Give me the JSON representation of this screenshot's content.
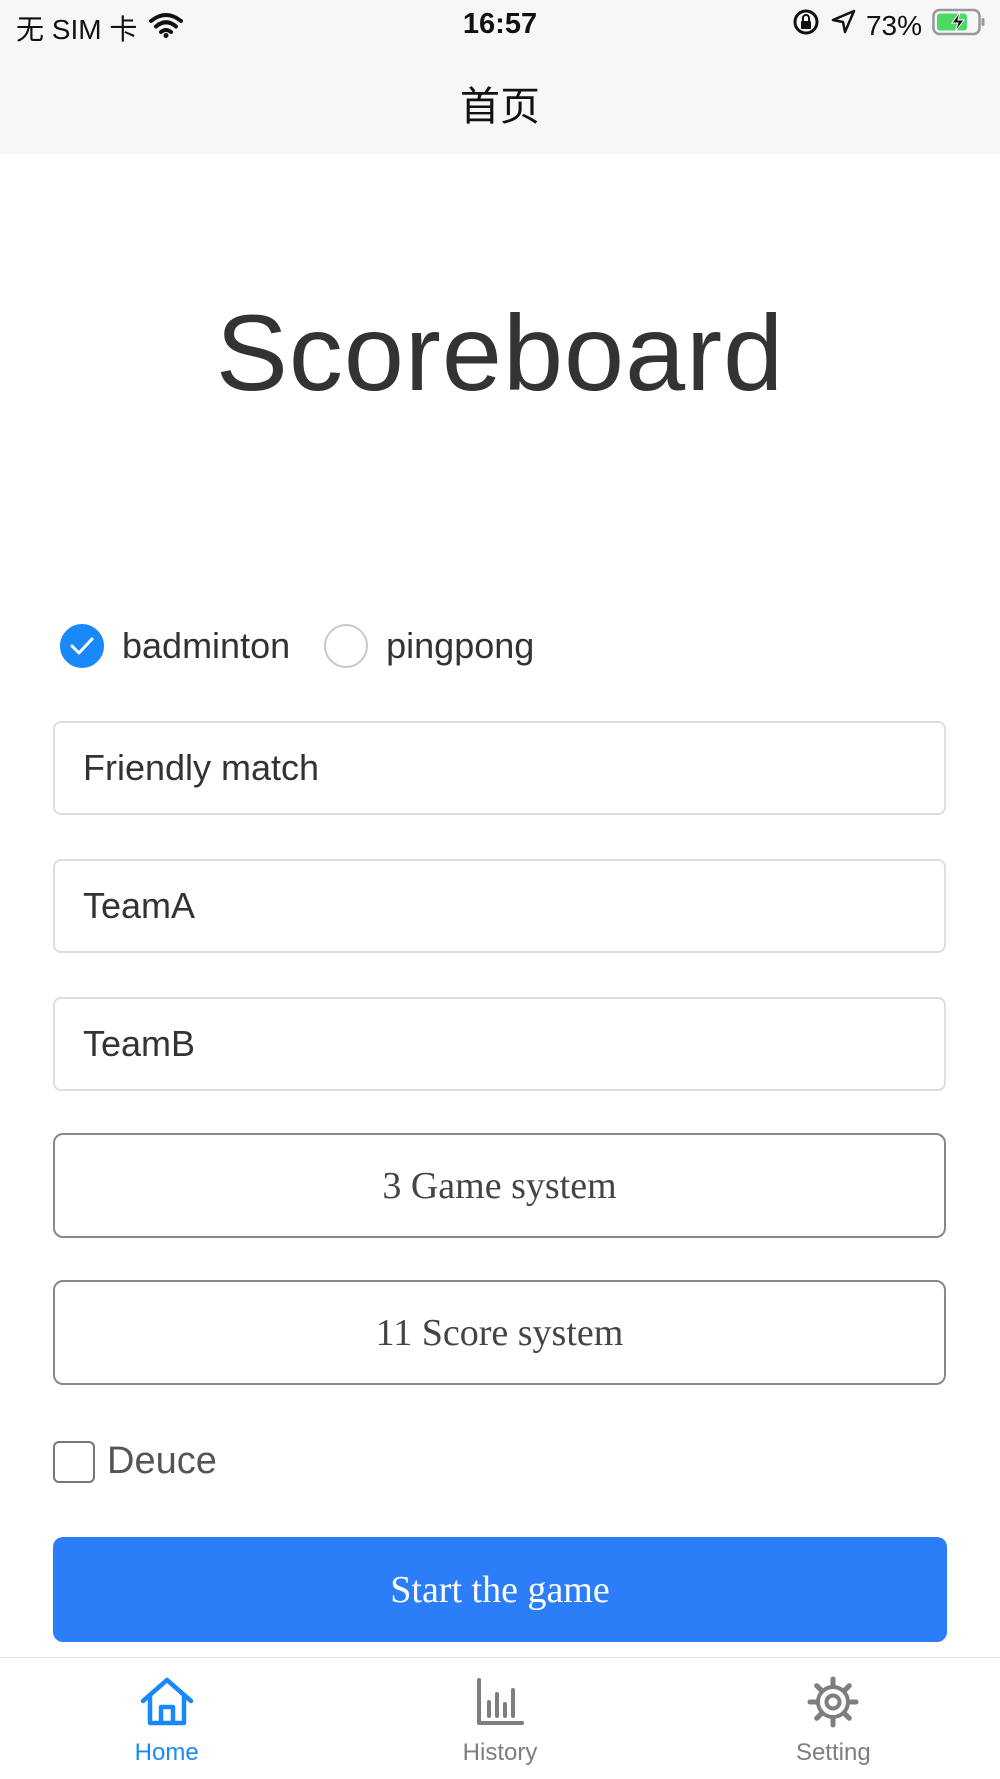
{
  "status_bar": {
    "carrier": "无 SIM 卡",
    "time": "16:57",
    "battery": "73%"
  },
  "nav": {
    "title": "首页"
  },
  "app_title": "Scoreboard",
  "sport_options": [
    {
      "label": "badminton",
      "checked": true
    },
    {
      "label": "pingpong",
      "checked": false
    }
  ],
  "fields": {
    "match_name": "Friendly match",
    "team_a": "TeamA",
    "team_b": "TeamB"
  },
  "game_system_label": "3 Game system",
  "score_system_label": "11 Score system",
  "deuce": {
    "label": "Deuce",
    "checked": false
  },
  "start_label": "Start the game",
  "tabs": [
    {
      "label": "Home",
      "icon": "home-icon",
      "active": true
    },
    {
      "label": "History",
      "icon": "bar-chart-icon",
      "active": false
    },
    {
      "label": "Setting",
      "icon": "gear-icon",
      "active": false
    }
  ],
  "colors": {
    "accent": "#1989fa",
    "start_button": "#2c7ef8"
  }
}
